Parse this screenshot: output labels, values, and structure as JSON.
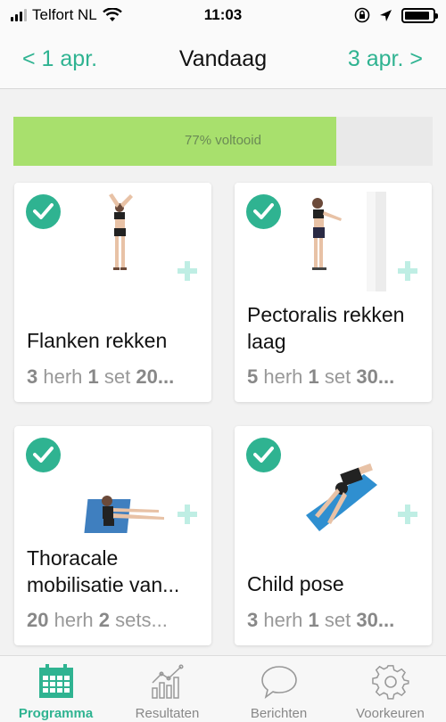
{
  "status_bar": {
    "carrier": "Telfort NL",
    "time": "11:03",
    "icons": [
      "signal-icon",
      "wifi-icon",
      "orientation-lock-icon",
      "location-icon",
      "battery-icon"
    ]
  },
  "header": {
    "prev_label": "< 1 apr.",
    "title": "Vandaag",
    "next_label": "3 apr. >"
  },
  "progress": {
    "percent": 77,
    "label": "77% voltooid",
    "fill_color": "#a8e06d",
    "track_color": "#e9e9e9"
  },
  "colors": {
    "accent": "#2fb391",
    "plus_icon": "#bfeee4"
  },
  "exercises": [
    {
      "title": "Flanken rekken",
      "reps_value": "3",
      "reps_unit": "herh",
      "sets_value": "1",
      "sets_unit": "set",
      "extra": "20...",
      "completed": true
    },
    {
      "title": "Pectoralis rekken laag",
      "reps_value": "5",
      "reps_unit": "herh",
      "sets_value": "1",
      "sets_unit": "set",
      "extra": "30...",
      "completed": true
    },
    {
      "title": "Thoracale mobilisatie van...",
      "reps_value": "20",
      "reps_unit": "herh",
      "sets_value": "2",
      "sets_unit": "sets...",
      "extra": "",
      "completed": true
    },
    {
      "title": "Child pose",
      "reps_value": "3",
      "reps_unit": "herh",
      "sets_value": "1",
      "sets_unit": "set",
      "extra": "30...",
      "completed": true
    }
  ],
  "tabs": [
    {
      "label": "Programma",
      "icon": "calendar-icon",
      "active": true
    },
    {
      "label": "Resultaten",
      "icon": "chart-icon",
      "active": false
    },
    {
      "label": "Berichten",
      "icon": "chat-bubble-icon",
      "active": false
    },
    {
      "label": "Voorkeuren",
      "icon": "gear-icon",
      "active": false
    }
  ]
}
